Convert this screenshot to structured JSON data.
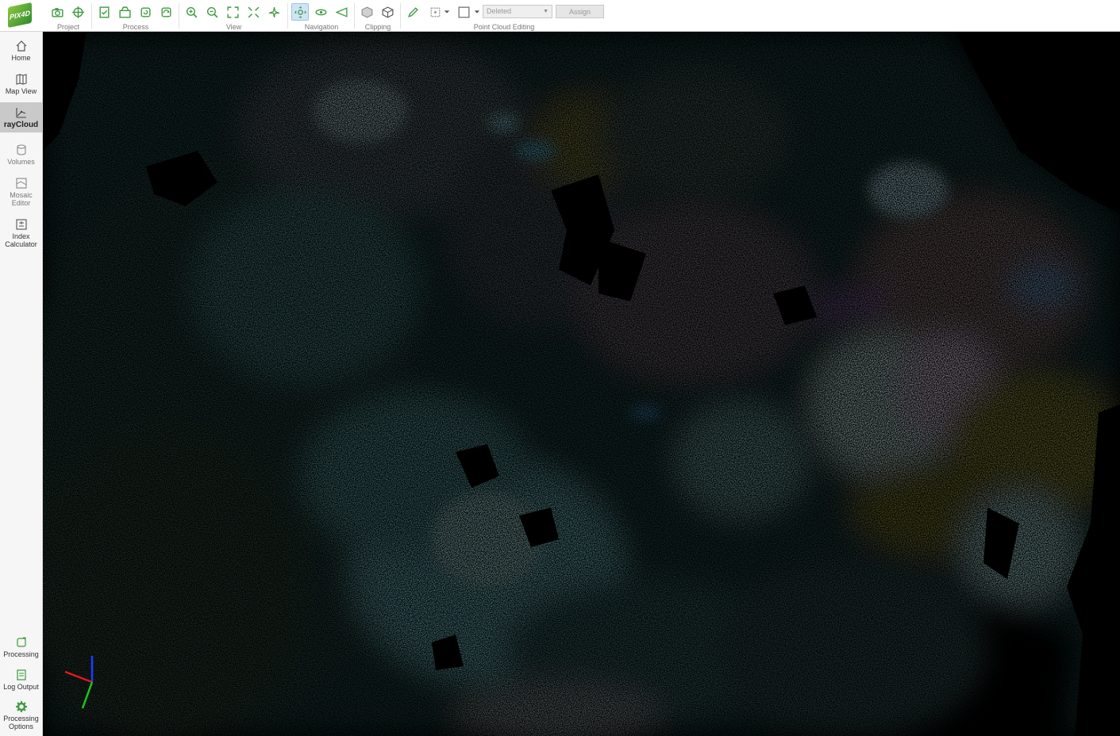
{
  "app": {
    "logo_text": "PIX4D"
  },
  "toolbar": {
    "groups": {
      "project": "Project",
      "process": "Process",
      "view": "View",
      "navigation": "Navigation",
      "clipping": "Clipping",
      "editing": "Point Cloud Editing"
    },
    "class_dropdown": {
      "value": "Deleted"
    },
    "assign_label": "Assign"
  },
  "sidebar": {
    "items": [
      {
        "label": "Home",
        "icon": "home-icon"
      },
      {
        "label": "Map View",
        "icon": "map-icon"
      },
      {
        "label": "rayCloud",
        "icon": "raycloud-icon",
        "active": true
      },
      {
        "label": "Volumes",
        "icon": "cylinder-icon"
      },
      {
        "label": "Mosaic Editor",
        "icon": "mosaic-icon"
      },
      {
        "label": "Index Calculator",
        "icon": "index-calculator-icon"
      }
    ],
    "bottom_items": [
      {
        "label": "Processing",
        "icon": "processing-icon"
      },
      {
        "label": "Log Output",
        "icon": "log-icon"
      },
      {
        "label": "Processing Options",
        "icon": "gear-icon"
      }
    ]
  },
  "colors": {
    "accent_green": "#3d9a3d",
    "active_blue": "#cfe4f7",
    "viewport_bg": "#000000"
  }
}
